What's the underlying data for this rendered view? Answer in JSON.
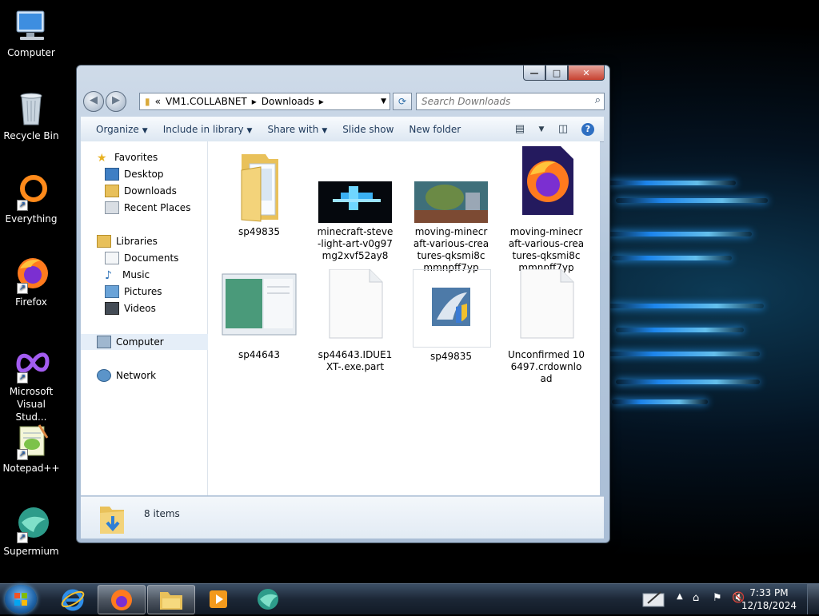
{
  "desktop": {
    "icons": [
      {
        "label": "Computer"
      },
      {
        "label": "Recycle Bin"
      },
      {
        "label": "Everything"
      },
      {
        "label": "Firefox"
      },
      {
        "label": "Microsoft Visual Stud..."
      },
      {
        "label": "Notepad++"
      },
      {
        "label": "Supermium"
      }
    ]
  },
  "window": {
    "caption_buttons": {
      "minimize": "—",
      "maximize": "□",
      "close": "✕"
    },
    "address": {
      "chevron": "«",
      "crumbs": [
        "VM1.COLLABNET",
        "Downloads"
      ],
      "separator": "▸"
    },
    "search": {
      "placeholder": "Search Downloads"
    },
    "toolbar": {
      "organize": "Organize",
      "include": "Include in library",
      "share": "Share with",
      "slideshow": "Slide show",
      "new_folder": "New folder"
    },
    "nav": {
      "favorites": "Favorites",
      "desktop": "Desktop",
      "downloads": "Downloads",
      "recent": "Recent Places",
      "libraries": "Libraries",
      "documents": "Documents",
      "music": "Music",
      "pictures": "Pictures",
      "videos": "Videos",
      "computer": "Computer",
      "network": "Network"
    },
    "files": [
      {
        "name": "sp49835"
      },
      {
        "name": "minecraft-steve-light-art-v0g97mg2xvf52ay8"
      },
      {
        "name": "moving-minecraft-various-creatures-qksmi8cmmnpff7yp"
      },
      {
        "name": "moving-minecraft-various-creatures-qksmi8cmmnpff7yp"
      },
      {
        "name": "sp44643"
      },
      {
        "name": "sp44643.IDUE1XT-.exe.part"
      },
      {
        "name": "sp49835"
      },
      {
        "name": "Unconfirmed 106497.crdownload"
      }
    ],
    "details": {
      "count": "8 items"
    }
  },
  "taskbar": {
    "clock_time": "7:33 PM",
    "clock_date": "12/18/2024"
  }
}
